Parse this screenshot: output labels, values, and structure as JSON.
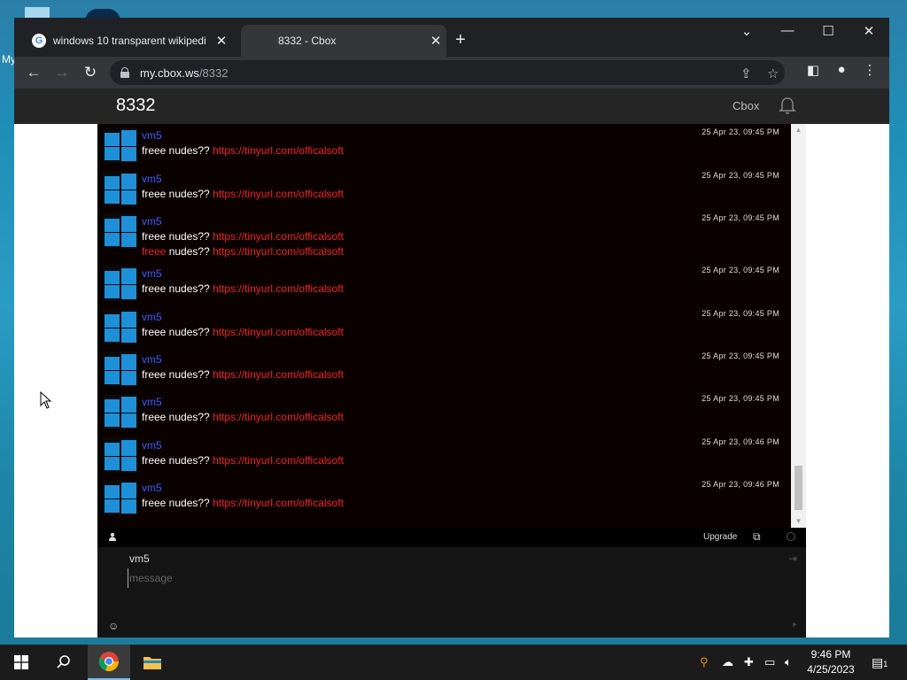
{
  "desktop": {
    "label": "My"
  },
  "browser": {
    "tabs": [
      {
        "title": "windows 10 transparent wikipedi",
        "active": false
      },
      {
        "title": "8332 - Cbox",
        "active": true
      }
    ],
    "url_host": "my.cbox.ws",
    "url_path": "/8332"
  },
  "cbox": {
    "title": "8332",
    "brand": "Cbox",
    "messages": [
      {
        "user": "vm5",
        "lines": [
          {
            "prefix": "freee nudes?? ",
            "link": "https://tinyurl.com/officalsoft"
          }
        ],
        "time": "25 Apr 23, 09:45 PM"
      },
      {
        "user": "vm5",
        "lines": [
          {
            "prefix": "freee nudes?? ",
            "link": "https://tinyurl.com/officalsoft"
          }
        ],
        "time": "25 Apr 23, 09:45 PM"
      },
      {
        "user": "vm5",
        "lines": [
          {
            "prefix": "freee nudes?? ",
            "link": "https://tinyurl.com/officalsoft"
          },
          {
            "prefix_red": "freee",
            "prefix": " nudes?? ",
            "link": "https://tinyurl.com/officalsoft"
          }
        ],
        "time": "25 Apr 23, 09:45 PM"
      },
      {
        "user": "vm5",
        "lines": [
          {
            "prefix": "freee nudes?? ",
            "link": "https://tinyurl.com/officalsoft"
          }
        ],
        "time": "25 Apr 23, 09:45 PM"
      },
      {
        "user": "vm5",
        "lines": [
          {
            "prefix": "freee nudes?? ",
            "link": "https://tinyurl.com/officalsoft"
          }
        ],
        "time": "25 Apr 23, 09:45 PM"
      },
      {
        "user": "vm5",
        "lines": [
          {
            "prefix": "freee nudes?? ",
            "link": "https://tinyurl.com/officalsoft"
          }
        ],
        "time": "25 Apr 23, 09:45 PM"
      },
      {
        "user": "vm5",
        "lines": [
          {
            "prefix": "freee nudes?? ",
            "link": "https://tinyurl.com/officalsoft"
          }
        ],
        "time": "25 Apr 23, 09:45 PM"
      },
      {
        "user": "vm5",
        "lines": [
          {
            "prefix": "freee nudes?? ",
            "link": "https://tinyurl.com/officalsoft"
          }
        ],
        "time": "25 Apr 23, 09:46 PM"
      },
      {
        "user": "vm5",
        "lines": [
          {
            "prefix": "freee nudes?? ",
            "link": "https://tinyurl.com/officalsoft"
          }
        ],
        "time": "25 Apr 23, 09:46 PM"
      }
    ],
    "upgrade_label": "Upgrade",
    "compose": {
      "name": "vm5",
      "placeholder": "message"
    }
  },
  "taskbar": {
    "time": "9:46 PM",
    "date": "4/25/2023",
    "notification_count": "1"
  }
}
